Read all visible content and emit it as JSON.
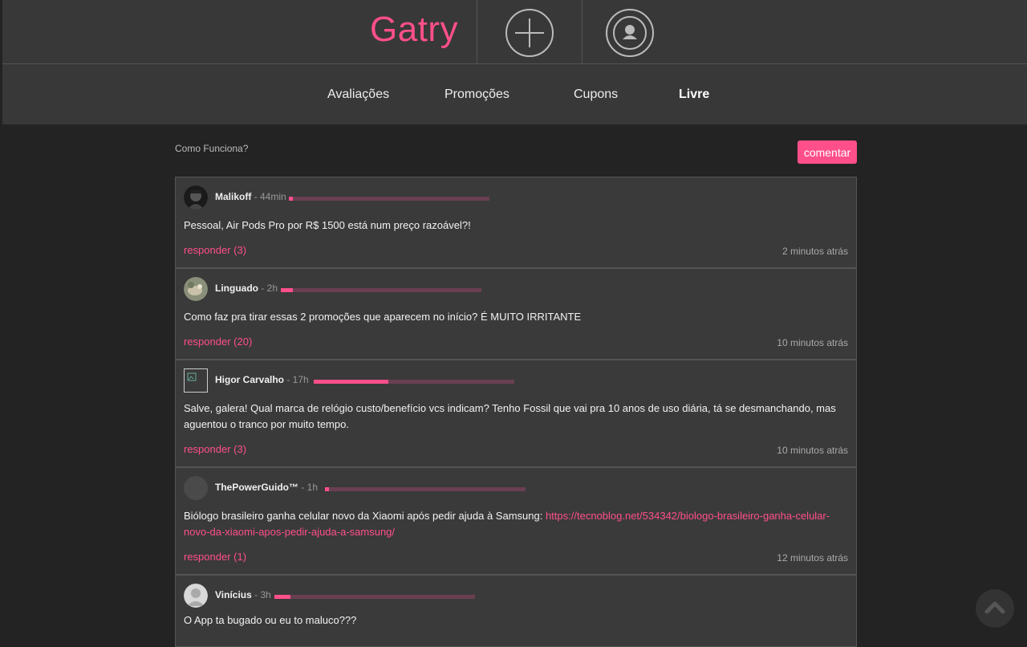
{
  "header": {
    "logo": "Gatry",
    "nav": [
      {
        "label": "Avaliações"
      },
      {
        "label": "Promoções"
      },
      {
        "label": "Cupons"
      },
      {
        "label": "Livre",
        "active": true
      }
    ]
  },
  "subbar": {
    "how_it_works": "Como Funciona?",
    "comment_button": "comentar"
  },
  "posts": [
    {
      "user": "Malikoff",
      "meta": " - 44min",
      "level": 0.02,
      "text": "Pessoal, Air Pods Pro por R$ 1500 está num preço razoável?!",
      "reply": "responder (3)",
      "time": "2 minutos atrás"
    },
    {
      "user": "Linguado",
      "meta": " - 2h",
      "level": 0.06,
      "text": "Como faz pra tirar essas 2 promoções que aparecem no início?  É MUITO IRRITANTE",
      "reply": "responder (20)",
      "time": "10 minutos atrás"
    },
    {
      "user": "Higor Carvalho",
      "meta": " - 17h",
      "level": 0.37,
      "text": "Salve, galera! Qual marca de relógio custo/benefício vcs indicam? Tenho Fossil que vai pra 10 anos de uso diária, tá se desmanchando, mas aguentou o tranco por muito tempo.",
      "reply": "responder (3)",
      "time": "10 minutos atrás"
    },
    {
      "user": "ThePowerGuido™",
      "meta": " - 1h",
      "level": 0.02,
      "text": "Biólogo brasileiro ganha celular novo da Xiaomi após pedir ajuda à Samsung: ",
      "link": "https://tecnoblog.net/534342/biologo-brasileiro-ganha-celular-novo-da-xiaomi-apos-pedir-ajuda-a-samsung/",
      "reply": "responder (1)",
      "time": "12 minutos atrás"
    },
    {
      "user": "Vinícius",
      "meta": " - 3h",
      "level": 0.08,
      "text": "O App ta bugado ou eu to maluco???",
      "reply": "",
      "time": ""
    }
  ],
  "colors": {
    "accent": "#ff4f8b",
    "background": "#232323",
    "header_bg": "#383838",
    "card_bg": "#3a3a3a"
  },
  "icons": [
    "plus-icon",
    "user-icon",
    "chevron-up-icon"
  ]
}
